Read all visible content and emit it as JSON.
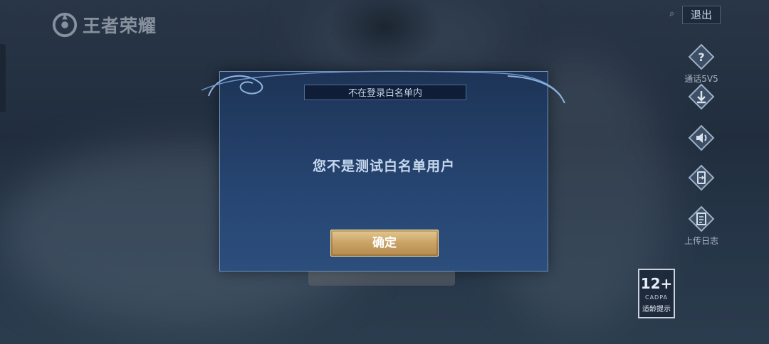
{
  "logo": {
    "text": "王者荣耀"
  },
  "top_bar": {
    "exit_label": "退出"
  },
  "right_menu": [
    {
      "icon": "question-icon",
      "label": "通话5V5"
    },
    {
      "icon": "download-icon",
      "label": ""
    },
    {
      "icon": "speaker-icon",
      "label": ""
    },
    {
      "icon": "switch-icon",
      "label": ""
    },
    {
      "icon": "clipboard-icon",
      "label": "上传日志"
    }
  ],
  "age_badge": {
    "rating": "12+",
    "org": "CADPA",
    "tip": "适龄提示"
  },
  "dialog": {
    "title": "不在登录白名单内",
    "message": "您不是测试白名单用户",
    "confirm_label": "确定"
  },
  "colors": {
    "dialog_bg": "#264470",
    "dialog_border": "#6f93c4",
    "button_gold": "#c9a266",
    "title_bar_bg": "#0f1d36"
  }
}
